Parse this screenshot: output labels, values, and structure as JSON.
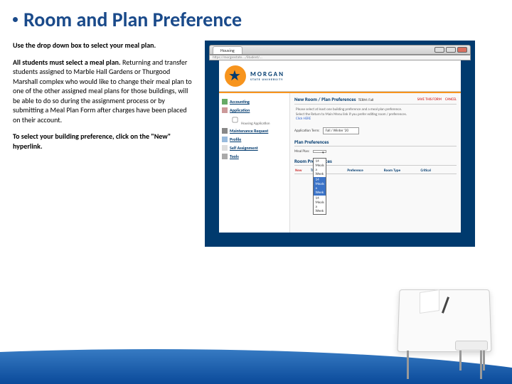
{
  "title": "Room and Plan Preference",
  "left": {
    "p1": "Use the drop down box to select your meal plan.",
    "p2a": "All students must select a meal plan.",
    "p2b": " Returning and transfer students assigned to Marble Hall Gardens or Thurgood Marshall complex who would like to change their meal plan to one of the other assigned meal plans for those buildings, will be able to do so during the assignment process or by submitting a Meal Plan Form after charges have been placed on their account.",
    "p3": "To select your building preference, click on the \"New\" hyperlink."
  },
  "browser": {
    "tab": "Housing",
    "url": "https://morganstate..../Student/..."
  },
  "morgan": {
    "name": "MORGAN",
    "sub": "STATE UNIVERSITY"
  },
  "nav": {
    "accounting": "Accounting",
    "application": "Application",
    "housing_app": "Housing Application",
    "maintenance": "Maintenance Request",
    "profile": "Profile",
    "self": "Self Assignment",
    "tools": "Tools"
  },
  "page": {
    "heading": "New Room / Plan Preferences",
    "term": "TERM: Fall",
    "save": "SAVE THIS FORM",
    "cancel": "CANCEL",
    "instr1": "Please select at least one building preference and a meal plan preference.",
    "instr2": "Select the Return to Main Menu link if you prefer editing room / preferences.",
    "clickhere": "Click HERE",
    "app_label": "Application Term:",
    "app_value": "Fall / Winter '20",
    "plan_section": "Plan Preferences",
    "plan_label": "Meal Plan:",
    "options": [
      "",
      "14 Meals a Week",
      "14 Meals a Week",
      "14 Meals a Week"
    ],
    "room_section": "Room Preferences",
    "cols": [
      "New",
      "Type",
      "Preference",
      "Room Type",
      "Critical"
    ]
  }
}
